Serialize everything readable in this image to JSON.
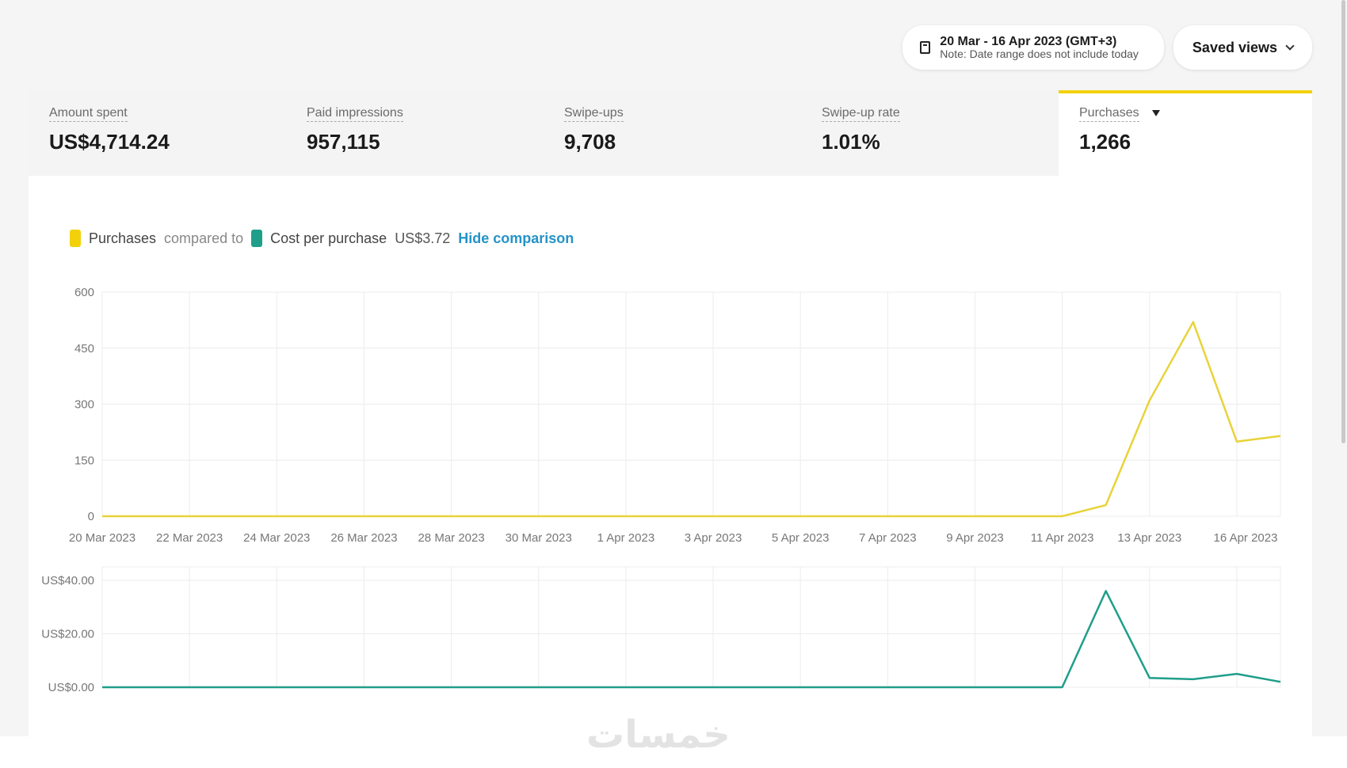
{
  "header": {
    "date_range": "20 Mar - 16 Apr 2023 (GMT+3)",
    "date_note": "Note: Date range does not include today",
    "saved_views_label": "Saved views"
  },
  "metrics": [
    {
      "label": "Amount spent",
      "value": "US$4,714.24"
    },
    {
      "label": "Paid impressions",
      "value": "957,115"
    },
    {
      "label": "Swipe-ups",
      "value": "9,708"
    },
    {
      "label": "Swipe-up rate",
      "value": "1.01%"
    },
    {
      "label": "Purchases",
      "value": "1,266"
    }
  ],
  "legend": {
    "primary": "Purchases",
    "compared_to": "compared to",
    "secondary": "Cost per purchase",
    "secondary_value": "US$3.72",
    "hide_link": "Hide comparison"
  },
  "colors": {
    "purchases": "#e8d33a",
    "cost": "#1f9e8a",
    "link": "#2393c9",
    "active_tab": "#f2d10a"
  },
  "watermark": "خمسات",
  "chart_data": [
    {
      "type": "line",
      "series": [
        {
          "x": [
            "20 Mar 2023",
            "21 Mar 2023",
            "22 Mar 2023",
            "23 Mar 2023",
            "24 Mar 2023",
            "25 Mar 2023",
            "26 Mar 2023",
            "27 Mar 2023",
            "28 Mar 2023",
            "29 Mar 2023",
            "30 Mar 2023",
            "31 Mar 2023",
            "1 Apr 2023",
            "2 Apr 2023",
            "3 Apr 2023",
            "4 Apr 2023",
            "5 Apr 2023",
            "6 Apr 2023",
            "7 Apr 2023",
            "8 Apr 2023",
            "9 Apr 2023",
            "10 Apr 2023",
            "11 Apr 2023",
            "12 Apr 2023",
            "13 Apr 2023",
            "14 Apr 2023",
            "15 Apr 2023",
            "16 Apr 2023"
          ],
          "values": [
            0,
            0,
            0,
            0,
            0,
            0,
            0,
            0,
            0,
            0,
            0,
            0,
            0,
            0,
            0,
            0,
            0,
            0,
            0,
            0,
            0,
            0,
            0,
            30,
            310,
            520,
            200,
            215
          ]
        }
      ],
      "x_tick_labels": [
        "20 Mar 2023",
        "22 Mar 2023",
        "24 Mar 2023",
        "26 Mar 2023",
        "28 Mar 2023",
        "30 Mar 2023",
        "1 Apr 2023",
        "3 Apr 2023",
        "5 Apr 2023",
        "7 Apr 2023",
        "9 Apr 2023",
        "11 Apr 2023",
        "13 Apr 2023",
        "16 Apr 2023"
      ],
      "y_ticks": [
        0,
        150,
        300,
        450,
        600
      ],
      "ylim": [
        0,
        600
      ],
      "grid": true
    },
    {
      "type": "line",
      "series": [
        {
          "x": [
            "20 Mar 2023",
            "21 Mar 2023",
            "22 Mar 2023",
            "23 Mar 2023",
            "24 Mar 2023",
            "25 Mar 2023",
            "26 Mar 2023",
            "27 Mar 2023",
            "28 Mar 2023",
            "29 Mar 2023",
            "30 Mar 2023",
            "31 Mar 2023",
            "1 Apr 2023",
            "2 Apr 2023",
            "3 Apr 2023",
            "4 Apr 2023",
            "5 Apr 2023",
            "6 Apr 2023",
            "7 Apr 2023",
            "8 Apr 2023",
            "9 Apr 2023",
            "10 Apr 2023",
            "11 Apr 2023",
            "12 Apr 2023",
            "13 Apr 2023",
            "14 Apr 2023",
            "15 Apr 2023",
            "16 Apr 2023"
          ],
          "values": [
            0,
            0,
            0,
            0,
            0,
            0,
            0,
            0,
            0,
            0,
            0,
            0,
            0,
            0,
            0,
            0,
            0,
            0,
            0,
            0,
            0,
            0,
            0,
            36,
            3.5,
            3,
            5,
            2
          ]
        }
      ],
      "y_tick_labels": [
        "US$0.00",
        "US$20.00",
        "US$40.00"
      ],
      "y_ticks": [
        0,
        20,
        40
      ],
      "ylim": [
        0,
        45
      ],
      "grid": true
    }
  ]
}
